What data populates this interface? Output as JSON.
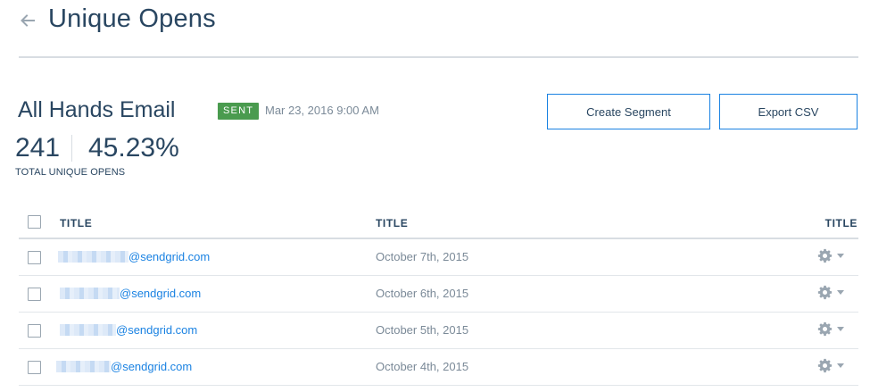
{
  "header": {
    "back_icon": "arrow-left-icon",
    "title": "Unique Opens"
  },
  "campaign": {
    "name": "All Hands Email",
    "status": "SENT",
    "status_color": "#4a9b4f",
    "sent_at": "Mar 23, 2016 9:00 AM",
    "total_unique_opens": "241",
    "open_rate": "45.23%",
    "stat_label": "TOTAL UNIQUE OPENS"
  },
  "actions": {
    "create_segment_label": "Create Segment",
    "export_csv_label": "Export CSV",
    "accent_color": "#1a82e2"
  },
  "table": {
    "columns": [
      "TITLE",
      "TITLE",
      "TITLE"
    ],
    "rows": [
      {
        "email": "@sendgrid.com",
        "date": "October 7th, 2015"
      },
      {
        "email": "@sendgrid.com",
        "date": "October 6th, 2015"
      },
      {
        "email": "@sendgrid.com",
        "date": "October 5th, 2015"
      },
      {
        "email": "@sendgrid.com",
        "date": "October 4th, 2015"
      }
    ],
    "row_action_icon": "gear-icon",
    "row_action_dropdown_icon": "caret-down-icon"
  }
}
